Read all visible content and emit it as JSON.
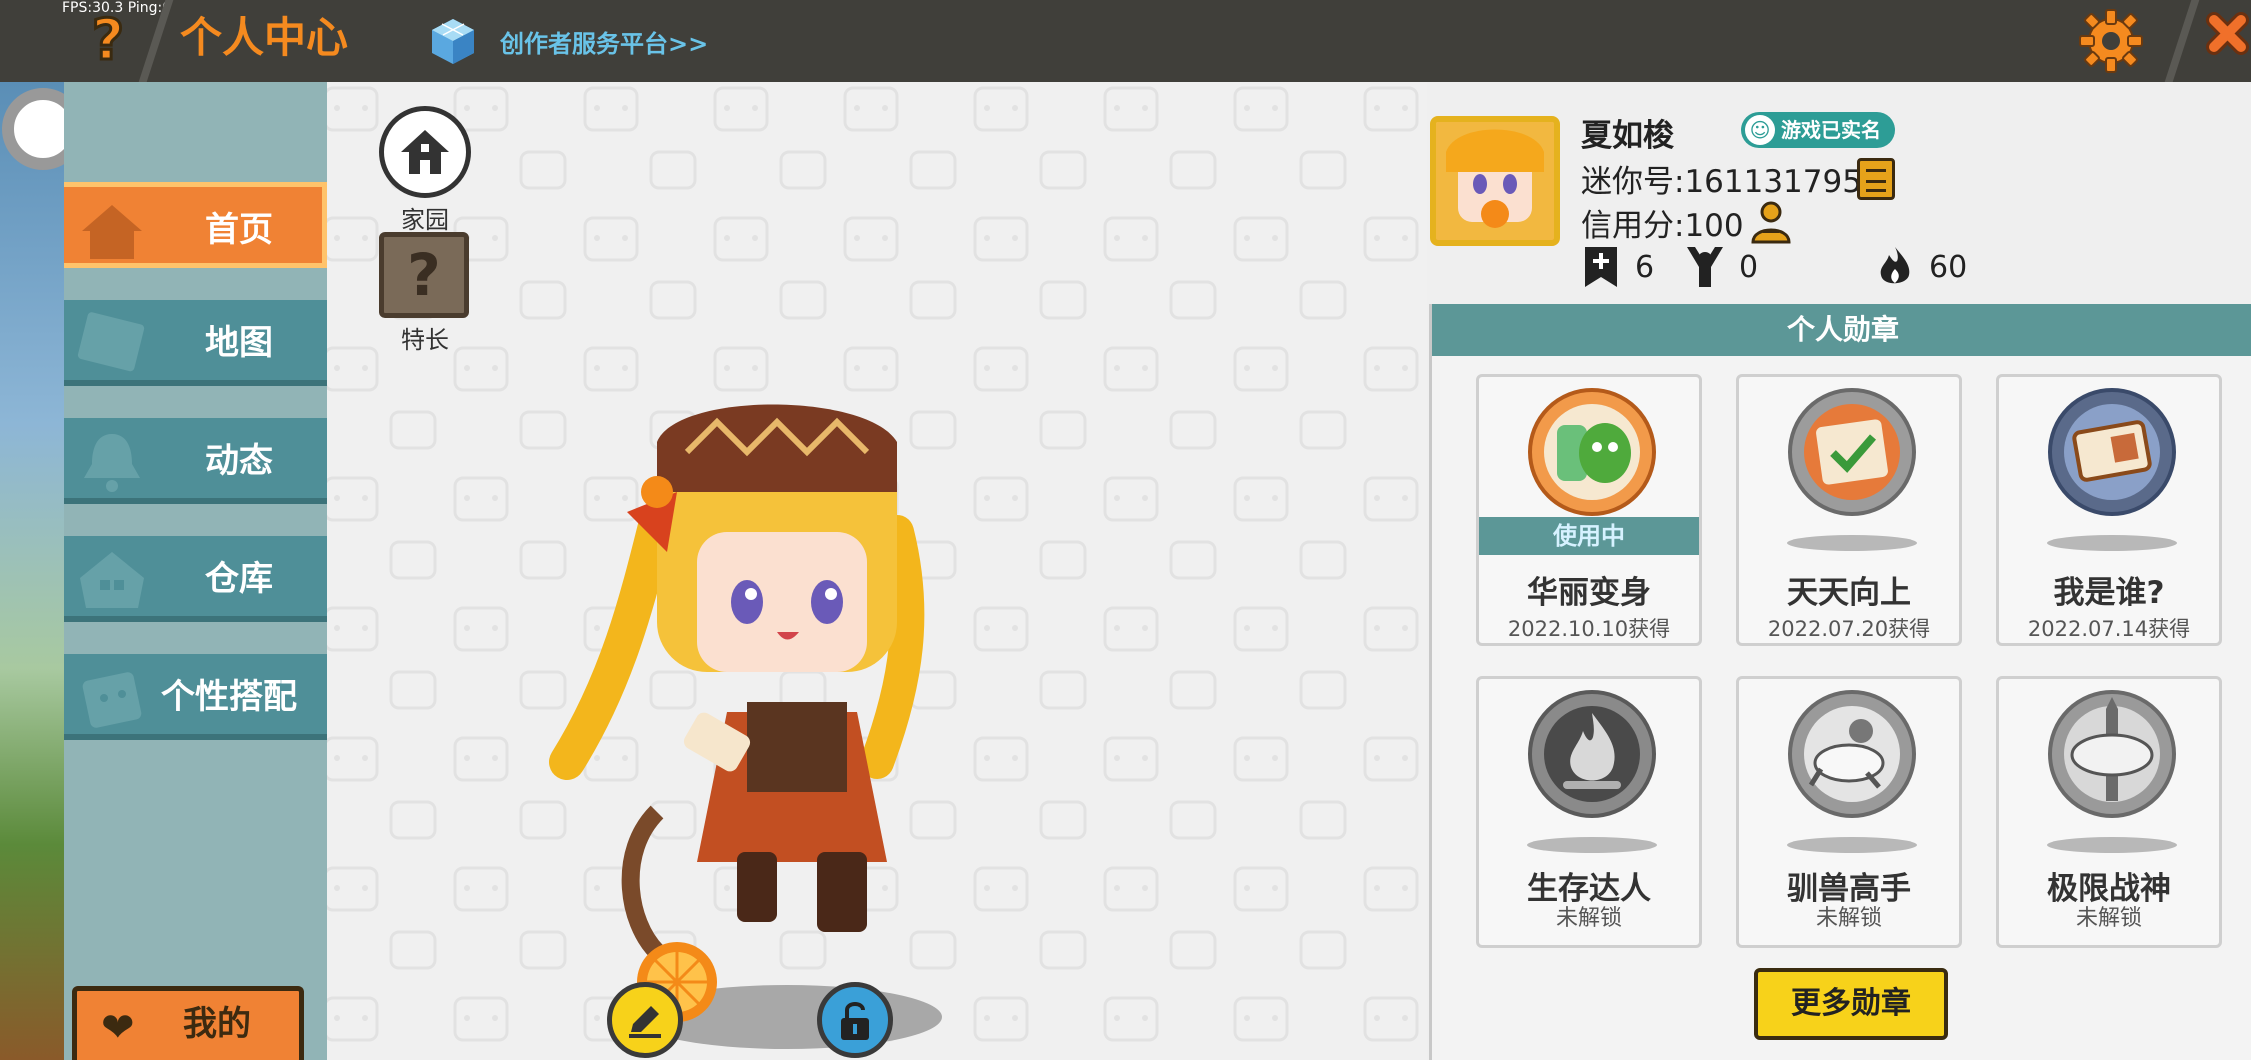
{
  "topbar": {
    "fps": "FPS:30.3  Ping:0",
    "help": "?",
    "title": "个人中心",
    "creator_link": "创作者服务平台>>"
  },
  "sidebar": {
    "items": [
      {
        "label": "首页",
        "active": true
      },
      {
        "label": "地图",
        "active": false
      },
      {
        "label": "动态",
        "active": false
      },
      {
        "label": "仓库",
        "active": false
      },
      {
        "label": "个性搭配",
        "active": false
      }
    ],
    "mine": "我的"
  },
  "quick": {
    "home": "家园",
    "skills": "特长"
  },
  "profile": {
    "name": "夏如梭",
    "verified": "游戏已实名",
    "mini_id": "迷你号:1611317952",
    "credit": "信用分:100",
    "stats": {
      "plus": "6",
      "fans": "0",
      "heat": "60"
    }
  },
  "medals": {
    "title": "个人勋章",
    "in_use": "使用中",
    "items": [
      {
        "name": "华丽变身",
        "date": "2022.10.10获得",
        "unlocked": true,
        "in_use": true
      },
      {
        "name": "天天向上",
        "date": "2022.07.20获得",
        "unlocked": true,
        "in_use": false
      },
      {
        "name": "我是谁?",
        "date": "2022.07.14获得",
        "unlocked": true,
        "in_use": false
      },
      {
        "name": "生存达人",
        "date": "未解锁",
        "unlocked": false,
        "in_use": false
      },
      {
        "name": "驯兽高手",
        "date": "未解锁",
        "unlocked": false,
        "in_use": false
      },
      {
        "name": "极限战神",
        "date": "未解锁",
        "unlocked": false,
        "in_use": false
      }
    ],
    "more": "更多勋章"
  },
  "colors": {
    "accent_orange": "#f08234",
    "teal": "#5c9797",
    "yellow": "#f7d21a"
  }
}
